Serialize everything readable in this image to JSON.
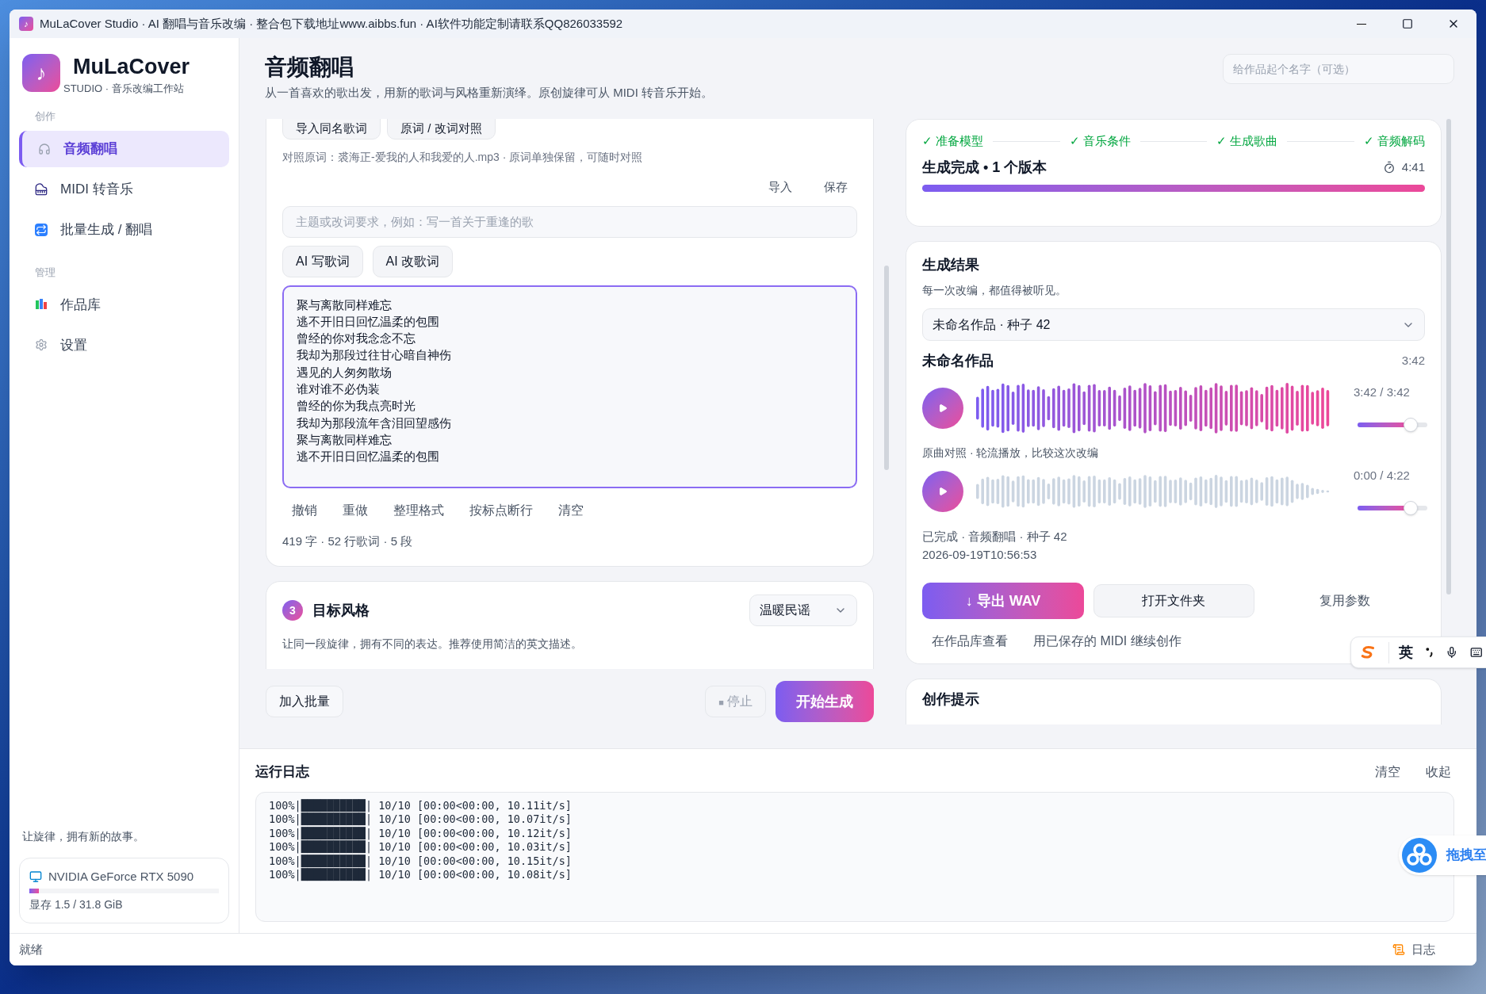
{
  "window": {
    "icon": "♪",
    "title": "MuLaCover Studio · AI 翻唱与音乐改编 · 整合包下载地址www.aibbs.fun · AI软件功能定制请联系QQ826033592"
  },
  "sidebar": {
    "brand": {
      "logo": "♪",
      "name": "MuLaCover",
      "subtitle": "STUDIO · 音乐改编工作站"
    },
    "sections": [
      {
        "label": "创作",
        "items": [
          {
            "label": "音频翻唱",
            "selected": true
          },
          {
            "label": "MIDI 转音乐",
            "selected": false
          },
          {
            "label": "批量生成 / 翻唱",
            "selected": false
          }
        ]
      },
      {
        "label": "管理",
        "items": [
          {
            "label": "作品库",
            "selected": false
          },
          {
            "label": "设置",
            "selected": false
          }
        ]
      }
    ],
    "tagline": "让旋律，拥有新的故事。",
    "gpu": {
      "name": "NVIDIA GeForce RTX 5090",
      "level": 0.05,
      "memory": "显存 1.5 / 31.8 GiB"
    }
  },
  "header": {
    "title": "音频翻唱",
    "subtitle": "从一首喜欢的歌出发，用新的歌词与风格重新演绎。原创旋律可从 MIDI 转音乐开始。",
    "name_field": {
      "placeholder": "给作品起个名字（可选）"
    }
  },
  "lyrics_card": {
    "top_buttons": [
      "导入同名歌词",
      "原词 / 改词对照"
    ],
    "reference_note": "对照原词：裘海正-爱我的人和我爱的人.mp3 · 原词单独保留，可随时对照",
    "file_actions": [
      "导入",
      "保存"
    ],
    "prompt_field": {
      "placeholder": "主题或改词要求，例如：写一首关于重逢的歌"
    },
    "ai_buttons": [
      "AI 写歌词",
      "AI 改歌词"
    ],
    "lyrics": [
      "聚与离散同样难忘",
      "逃不开旧日回忆温柔的包围",
      "曾经的你对我念念不忘",
      "我却为那段过往甘心暗自神伤",
      "遇见的人匆匆散场",
      "谁对谁不必伪装",
      "曾经的你为我点亮时光",
      "我却为那段流年含泪回望感伤",
      "聚与离散同样难忘",
      "逃不开旧日回忆温柔的包围"
    ],
    "edit_actions": [
      "撤销",
      "重做",
      "整理格式",
      "按标点断行",
      "清空"
    ],
    "stats": "419 字 · 52 行歌词 · 5 段"
  },
  "style_card": {
    "step": "3",
    "title": "目标风格",
    "select": {
      "value": "温暖民谣"
    },
    "description": "让同一段旋律，拥有不同的表达。推荐使用简洁的英文描述。"
  },
  "action_bar": {
    "batch_button": "加入批量",
    "stop_button": {
      "icon": "■",
      "label": "停止",
      "disabled": true
    },
    "start_button": "开始生成"
  },
  "progress_card": {
    "done_mark": "✓",
    "steps": [
      {
        "label": "准备模型",
        "done": true
      },
      {
        "label": "音乐条件",
        "done": true
      },
      {
        "label": "生成歌曲",
        "done": true
      },
      {
        "label": "音频解码",
        "done": true
      }
    ],
    "status": "生成完成 • 1 个版本",
    "elapsed": "4:41",
    "level": 1.0
  },
  "result_card": {
    "title": "生成结果",
    "subtitle": "每一次改编，都值得被听见。",
    "select": {
      "value": "未命名作品 · 种子 42"
    },
    "track_title": "未命名作品",
    "track_duration": "3:42",
    "players": [
      {
        "kind": "generated",
        "time": "3:42 / 3:42",
        "level": 0.76
      },
      {
        "kind": "original",
        "caption": "原曲对照 · 轮流播放，比较这次改编",
        "time": "0:00 / 4:22",
        "level": 0.76
      }
    ],
    "meta": "已完成 · 音频翻唱 · 种子 42",
    "timestamp": "2026-09-19T10:56:53",
    "export_button": {
      "icon": "↓",
      "label": "导出 WAV"
    },
    "folder_button": "打开文件夹",
    "reuse_button": "复用参数",
    "links": [
      "在作品库查看",
      "用已保存的 MIDI 继续创作"
    ]
  },
  "tips_card": {
    "title": "创作提示"
  },
  "log": {
    "title": "运行日志",
    "actions": [
      "清空",
      "收起"
    ],
    "lines": [
      "100%|██████████| 10/10 [00:00<00:00, 10.11it/s]",
      "100%|██████████| 10/10 [00:00<00:00, 10.07it/s]",
      "100%|██████████| 10/10 [00:00<00:00, 10.12it/s]",
      "100%|██████████| 10/10 [00:00<00:00, 10.03it/s]",
      "100%|██████████| 10/10 [00:00<00:00, 10.15it/s]",
      "100%|██████████| 10/10 [00:00<00:00, 10.08it/s]"
    ]
  },
  "status_bar": {
    "text": "就绪",
    "log_button": "日志"
  },
  "ime_toolbar": {
    "mode": "英"
  },
  "cloud_widget": {
    "label": "拖拽至"
  }
}
